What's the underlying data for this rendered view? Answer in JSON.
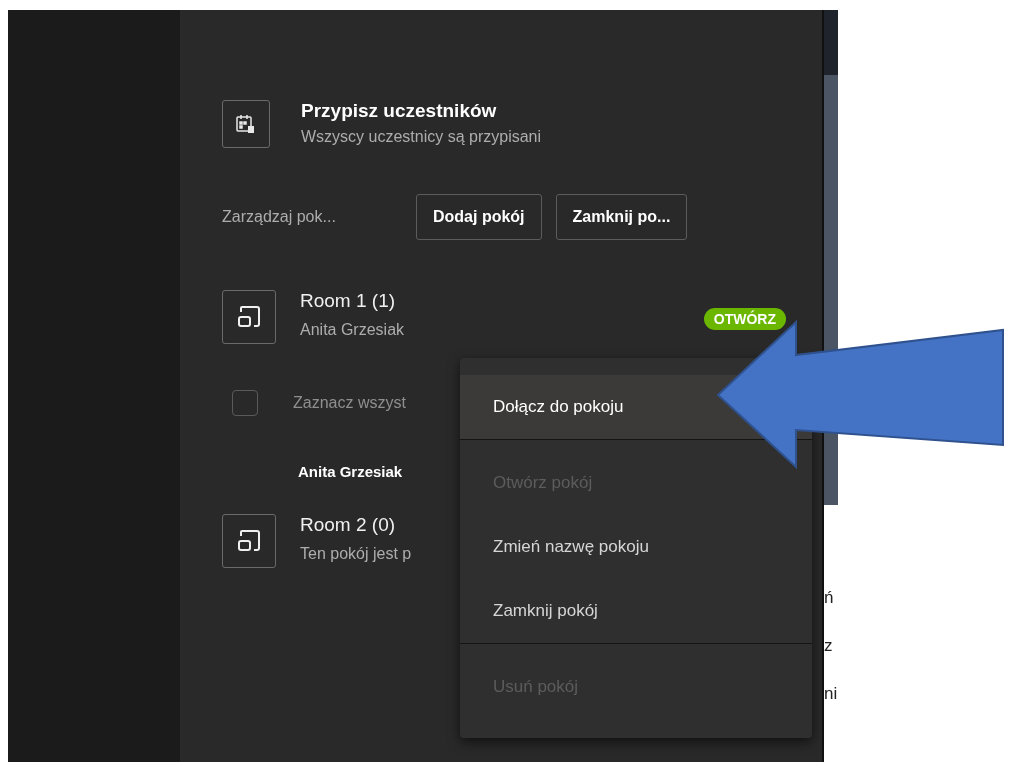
{
  "assign": {
    "title": "Przypisz uczestników",
    "subtitle": "Wszyscy uczestnicy są przypisani"
  },
  "toolbar": {
    "label": "Zarządzaj pok...",
    "buttons": [
      "Dodaj pokój",
      "Zamknij po..."
    ]
  },
  "rooms": [
    {
      "name": "Room 1 (1)",
      "subtitle": "Anita Grzesiak",
      "badge": "OTWÓRZ",
      "select_all": {
        "label": "Zaznacz wszyst",
        "checked": false
      },
      "members": [
        "Anita Grzesiak"
      ]
    },
    {
      "name": "Room 2 (0)",
      "subtitle": "Ten pokój jest p"
    }
  ],
  "context_menu": [
    {
      "label": "Dołącz do pokoju",
      "selected": true,
      "disabled": false,
      "divider_after": true
    },
    {
      "label": "Otwórz pokój",
      "selected": false,
      "disabled": true,
      "divider_after": false
    },
    {
      "label": "Zmień nazwę pokoju",
      "selected": false,
      "disabled": false,
      "divider_after": false
    },
    {
      "label": "Zamknij pokój",
      "selected": false,
      "disabled": false,
      "divider_after": true
    },
    {
      "label": "Usuń pokój",
      "selected": false,
      "disabled": true,
      "divider_after": false
    }
  ],
  "edge_fragments": [
    "ń",
    "z",
    "ni"
  ]
}
